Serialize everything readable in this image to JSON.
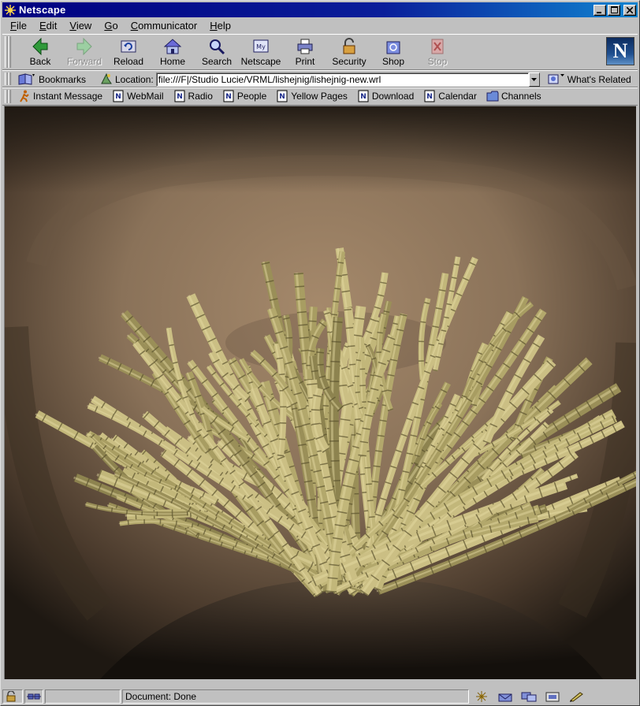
{
  "window": {
    "title": "Netscape"
  },
  "menu": [
    {
      "mn": "F",
      "rest": "ile"
    },
    {
      "mn": "E",
      "rest": "dit"
    },
    {
      "mn": "V",
      "rest": "iew"
    },
    {
      "mn": "G",
      "rest": "o"
    },
    {
      "mn": "C",
      "rest": "ommunicator"
    },
    {
      "mn": "H",
      "rest": "elp"
    }
  ],
  "nav_toolbar": {
    "back": "Back",
    "forward": "Forward",
    "reload": "Reload",
    "home": "Home",
    "search": "Search",
    "netscape": "Netscape",
    "print": "Print",
    "security": "Security",
    "shop": "Shop",
    "stop": "Stop"
  },
  "logo_letter": "N",
  "location_bar": {
    "bookmarks_label": "Bookmarks",
    "location_label": "Location:",
    "url": "file:///F|/Studio Lucie/VRML/lishejnig/lishejnig-new.wrl",
    "whats_related": "What's Related"
  },
  "personal_toolbar": [
    "Instant Message",
    "WebMail",
    "Radio",
    "People",
    "Yellow Pages",
    "Download",
    "Calendar",
    "Channels"
  ],
  "status": {
    "text": "Document: Done"
  },
  "colors": {
    "titlebar_start": "#000080",
    "titlebar_end": "#1084d0",
    "chrome": "#c0c0c0",
    "bamboo": "#b8ad72"
  }
}
